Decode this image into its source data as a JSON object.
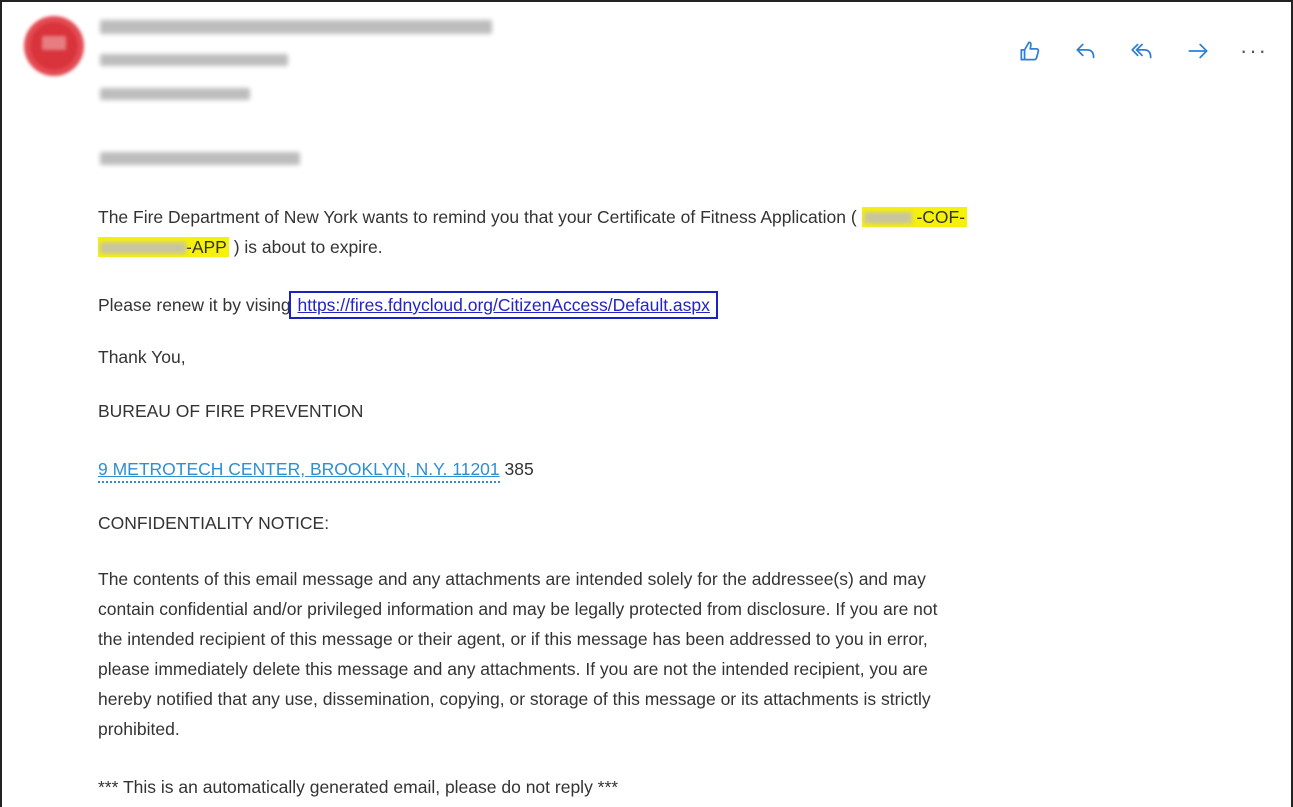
{
  "message": {
    "paragraph1_a": "The Fire Department of New York wants to remind you that your Certificate of Fitness Application (",
    "highlight_cof": "-COF-",
    "highlight_app": "-APP",
    "paragraph1_b": ") is about to expire.",
    "renew_prefix": "Please renew it by vising",
    "renew_link": "https://fires.fdnycloud.org/CitizenAccess/Default.aspx",
    "thanks": "Thank You,",
    "bureau": "BUREAU OF FIRE PREVENTION",
    "address_link": "9 METROTECH CENTER, BROOKLYN, N.Y. 11201",
    "address_suffix": "385",
    "confidentiality_heading": "CONFIDENTIALITY NOTICE:",
    "confidentiality_lines": [
      "The contents of this email message and any attachments are intended solely for the addressee(s) and may",
      "contain confidential and/or privileged information and may be legally protected from disclosure. If you are not",
      "the intended recipient of this message or their agent, or if this message has been addressed to you in error,",
      "please immediately delete this message and any attachments. If you are not the intended recipient, you are",
      "hereby notified that any use, dissemination, copying, or storage of this message or its attachments is strictly",
      "prohibited."
    ],
    "auto_notice": "*** This is an automatically generated email, please do not reply ***"
  },
  "actions": {
    "icons": [
      "like-icon",
      "reply-icon",
      "reply-all-icon",
      "forward-icon",
      "more-icon"
    ],
    "more_glyph": "···"
  },
  "colors": {
    "link": "#2323c6",
    "link_box": "#1a22c4",
    "address": "#2f8fd0",
    "highlight": "#f6f10a",
    "action_icon": "#2f7fd6"
  }
}
